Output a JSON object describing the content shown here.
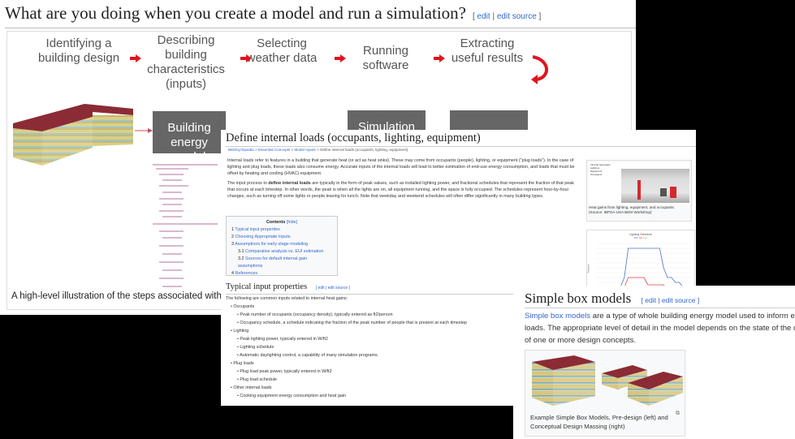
{
  "top_page": {
    "title": "What are you doing when you create a model and run a simulation?",
    "edit_open": "[",
    "edit": "edit",
    "separator": "|",
    "edit_source": "edit source",
    "edit_close": "]",
    "steps": [
      "Identifying a building design",
      "Describing building characteristics (inputs)",
      "Selecting weather data",
      "Running software",
      "Extracting useful results"
    ],
    "boxes": {
      "model": "Building energy model",
      "simulation": "Simulation"
    },
    "caption": "A high-level illustration of the steps associated with crea",
    "arrow_color": "#e0141e",
    "box_color": "#666666"
  },
  "internal_loads_page": {
    "title": "Define internal loads (occupants, lighting, equipment)",
    "breadcrumb": [
      "BEMcyclopedia",
      "Essential Concepts",
      "Model Inputs",
      "Define internal loads (occupants, lighting, equipment)"
    ],
    "breadcrumb_sep": ">",
    "para1": "Internal loads refer to features in a building that generate heat (or act as heat sinks). These may come from occupants (people), lighting, or equipment (\"plug loads\"). In the case of lighting and plug loads, these loads also consume energy. Accurate inputs of the internal loads will lead to better estimation of end-use energy consumption, and loads that must be offset by heating and cooling (HVAC) equipment.",
    "para2_before": "The input process to ",
    "para2_bold": "define internal loads",
    "para2_after": " are typically in the form of peak values, such as installed lighting power, and fractional schedules that represent the fraction of that peak that occurs at each timestep. In other words, the peak is when all the lights are on, all equipment running, and the space is fully occupied. The schedules represent hour-by-hour changes, such as turning off some lights or people leaving for lunch. Note that weekday and weekend schedules will often differ significantly in many building types.",
    "contents": {
      "title": "Contents",
      "hide": "[hide]",
      "items": [
        {
          "num": "1",
          "label": "Typical input properties"
        },
        {
          "num": "2",
          "label": "Choosing Appropriate Inputs"
        },
        {
          "num": "3",
          "label": "Assumptions for early stage modeling"
        },
        {
          "num": "3.1",
          "label": "Comparative analysis vs. EUI estimation"
        },
        {
          "num": "3.2",
          "label": "Sources for default internal gain assumptions"
        },
        {
          "num": "4",
          "label": "References"
        }
      ]
    },
    "section_title": "Typical input properties",
    "section_edit": "[ edit | edit source ]",
    "section_intro": "The following are common inputs related to internal heat gains:",
    "list": [
      {
        "label": "Occupants",
        "children": [
          "Peak number of occupants (occupancy density), typically entered as ft2/person",
          "Occupancy schedule, a schedule indicating the fraction of the peak number of people that is present at each timestep"
        ]
      },
      {
        "label": "Lighting",
        "children": [
          "Peak lighting power, typically entered in W/ft2",
          "Lighting schedule",
          "Automatic daylighting control, a capability of many simulation programs."
        ]
      },
      {
        "label": "Plug loads",
        "children": [
          "Plug load peak power, typically entered in W/ft2",
          "Plug load schedule"
        ]
      },
      {
        "label": "Other internal loads",
        "children": [
          "Cooking equipment energy consumption and heat gain"
        ]
      }
    ],
    "figure": {
      "inset_title": "Internal heat gains",
      "inset_legend": [
        "Lighting",
        "Equipment",
        "Occupants"
      ],
      "caption": "Heat gains from lighting, equipment, and occupants. (Source: IBPSA-USA BEM Workshop)"
    },
    "chart_data": {
      "type": "line",
      "title": "Lighting Schedule",
      "ylabel": "Fraction",
      "ylim": [
        0,
        1
      ],
      "x": [
        0,
        1,
        2,
        3,
        4,
        5,
        6,
        7,
        8,
        9,
        10,
        11,
        12,
        13,
        14,
        15,
        16,
        17,
        18,
        19,
        20,
        21,
        22,
        23,
        24
      ],
      "series": [
        {
          "name": "WD",
          "color": "#4a6fc9",
          "values": [
            0.05,
            0.05,
            0.05,
            0.05,
            0.05,
            0.1,
            0.1,
            0.3,
            0.9,
            0.9,
            0.9,
            0.9,
            0.9,
            0.9,
            0.9,
            0.9,
            0.9,
            0.5,
            0.3,
            0.3,
            0.2,
            0.2,
            0.1,
            0.05,
            0.05
          ]
        },
        {
          "name": "Sat",
          "color": "#d9434f",
          "values": [
            0.05,
            0.05,
            0.05,
            0.05,
            0.05,
            0.05,
            0.1,
            0.1,
            0.3,
            0.3,
            0.3,
            0.3,
            0.3,
            0.15,
            0.15,
            0.15,
            0.15,
            0.15,
            0.05,
            0.05,
            0.05,
            0.05,
            0.05,
            0.05,
            0.05
          ]
        },
        {
          "name": "Sun",
          "color": "#9bbb59",
          "values": [
            0.05,
            0.05,
            0.05,
            0.05,
            0.05,
            0.05,
            0.05,
            0.05,
            0.05,
            0.05,
            0.05,
            0.05,
            0.05,
            0.05,
            0.05,
            0.05,
            0.05,
            0.05,
            0.05,
            0.05,
            0.05,
            0.05,
            0.05,
            0.05,
            0.05
          ]
        }
      ]
    }
  },
  "box_models_page": {
    "title": "Simple box models",
    "edit": "[ edit | edit source ]",
    "link": "Simple box models",
    "text_line1": " are a type of whole building energy model used to inform early e",
    "text_line2": "loads. The appropriate level of detail in the model depends on the state of the desig",
    "text_line3": "of one or more design concepts.",
    "caption": "Example Simple Box Models, Pre-design (left) and Conceptual Design Massing (right)",
    "roof_color": "#8b2b35"
  }
}
